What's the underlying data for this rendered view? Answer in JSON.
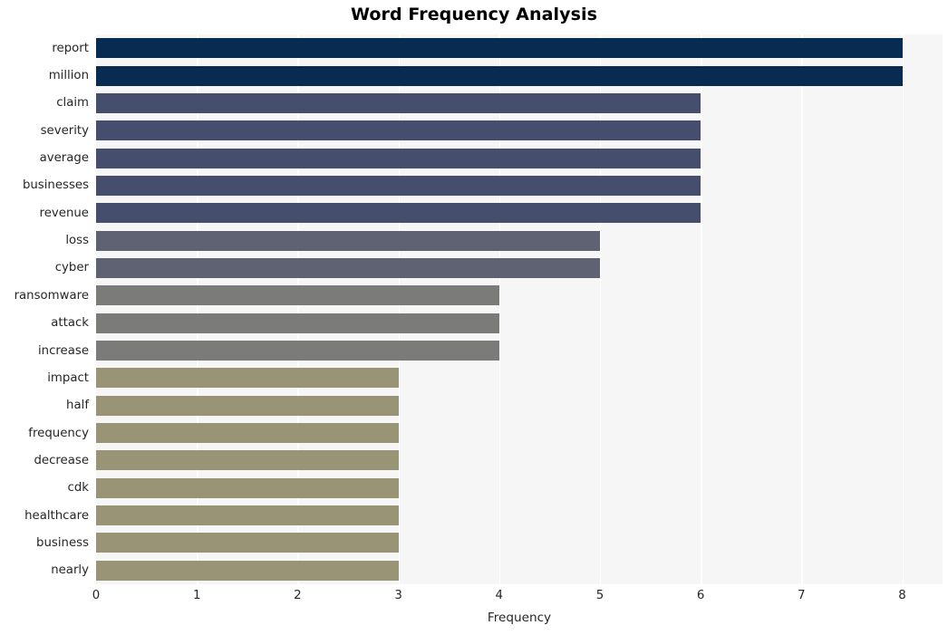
{
  "chart_data": {
    "type": "bar",
    "orientation": "horizontal",
    "title": "Word Frequency Analysis",
    "xlabel": "Frequency",
    "ylabel": "",
    "xlim": [
      0,
      8.4
    ],
    "xticks": [
      0,
      1,
      2,
      3,
      4,
      5,
      6,
      7,
      8
    ],
    "xtick_labels": [
      "0",
      "1",
      "2",
      "3",
      "4",
      "5",
      "6",
      "7",
      "8"
    ],
    "grid": "vertical-white-on-light-gray",
    "legend": "none",
    "categories": [
      "report",
      "million",
      "claim",
      "severity",
      "average",
      "businesses",
      "revenue",
      "loss",
      "cyber",
      "ransomware",
      "attack",
      "increase",
      "impact",
      "half",
      "frequency",
      "decrease",
      "cdk",
      "healthcare",
      "business",
      "nearly"
    ],
    "values": [
      8,
      8,
      6,
      6,
      6,
      6,
      6,
      5,
      5,
      4,
      4,
      4,
      3,
      3,
      3,
      3,
      3,
      3,
      3,
      3
    ],
    "bar_colors": [
      "#082B52",
      "#082B52",
      "#454F6D",
      "#454F6D",
      "#454F6D",
      "#454F6D",
      "#454F6D",
      "#5F6272",
      "#5F6272",
      "#7B7B79",
      "#7B7B79",
      "#7B7B79",
      "#9A9477",
      "#9A9477",
      "#9A9477",
      "#9A9477",
      "#9A9477",
      "#9A9477",
      "#9A9477",
      "#9A9477"
    ],
    "plot_background": "#F6F6F6",
    "figure_background": "#FFFFFF",
    "gridline_color": "#FFFFFF",
    "text_color": "#262626"
  }
}
